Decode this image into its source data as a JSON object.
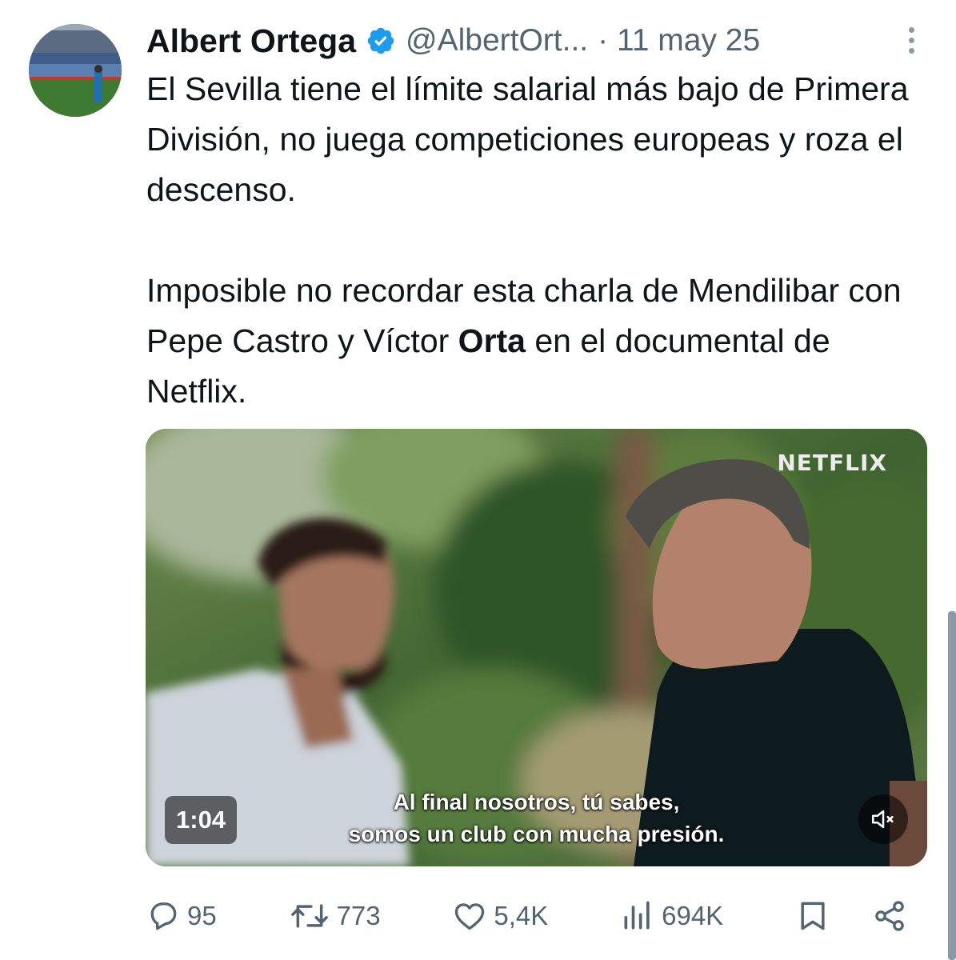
{
  "tweet": {
    "author_name": "Albert Ortega",
    "handle": "@AlbertOrt...",
    "date": "· 11 may 25",
    "paragraph1": "El Sevilla tiene el límite salarial más bajo de Primera División, no juega competiciones europeas y roza el descenso.",
    "paragraph2_before": "Imposible no recordar esta charla de Mendilibar con Pepe Castro y Víctor ",
    "paragraph2_bold": "Orta",
    "paragraph2_after": " en el documental de Netflix."
  },
  "media": {
    "watermark": "NETFLIX",
    "duration": "1:04",
    "subtitle_line1": "Al final nosotros, tú sabes,",
    "subtitle_line2": "somos un club con mucha presión."
  },
  "actions": {
    "replies": "95",
    "retweets": "773",
    "likes": "5,4K",
    "views": "694K"
  },
  "colors": {
    "verified": "#1d9bf0",
    "secondary_text": "#536471"
  }
}
